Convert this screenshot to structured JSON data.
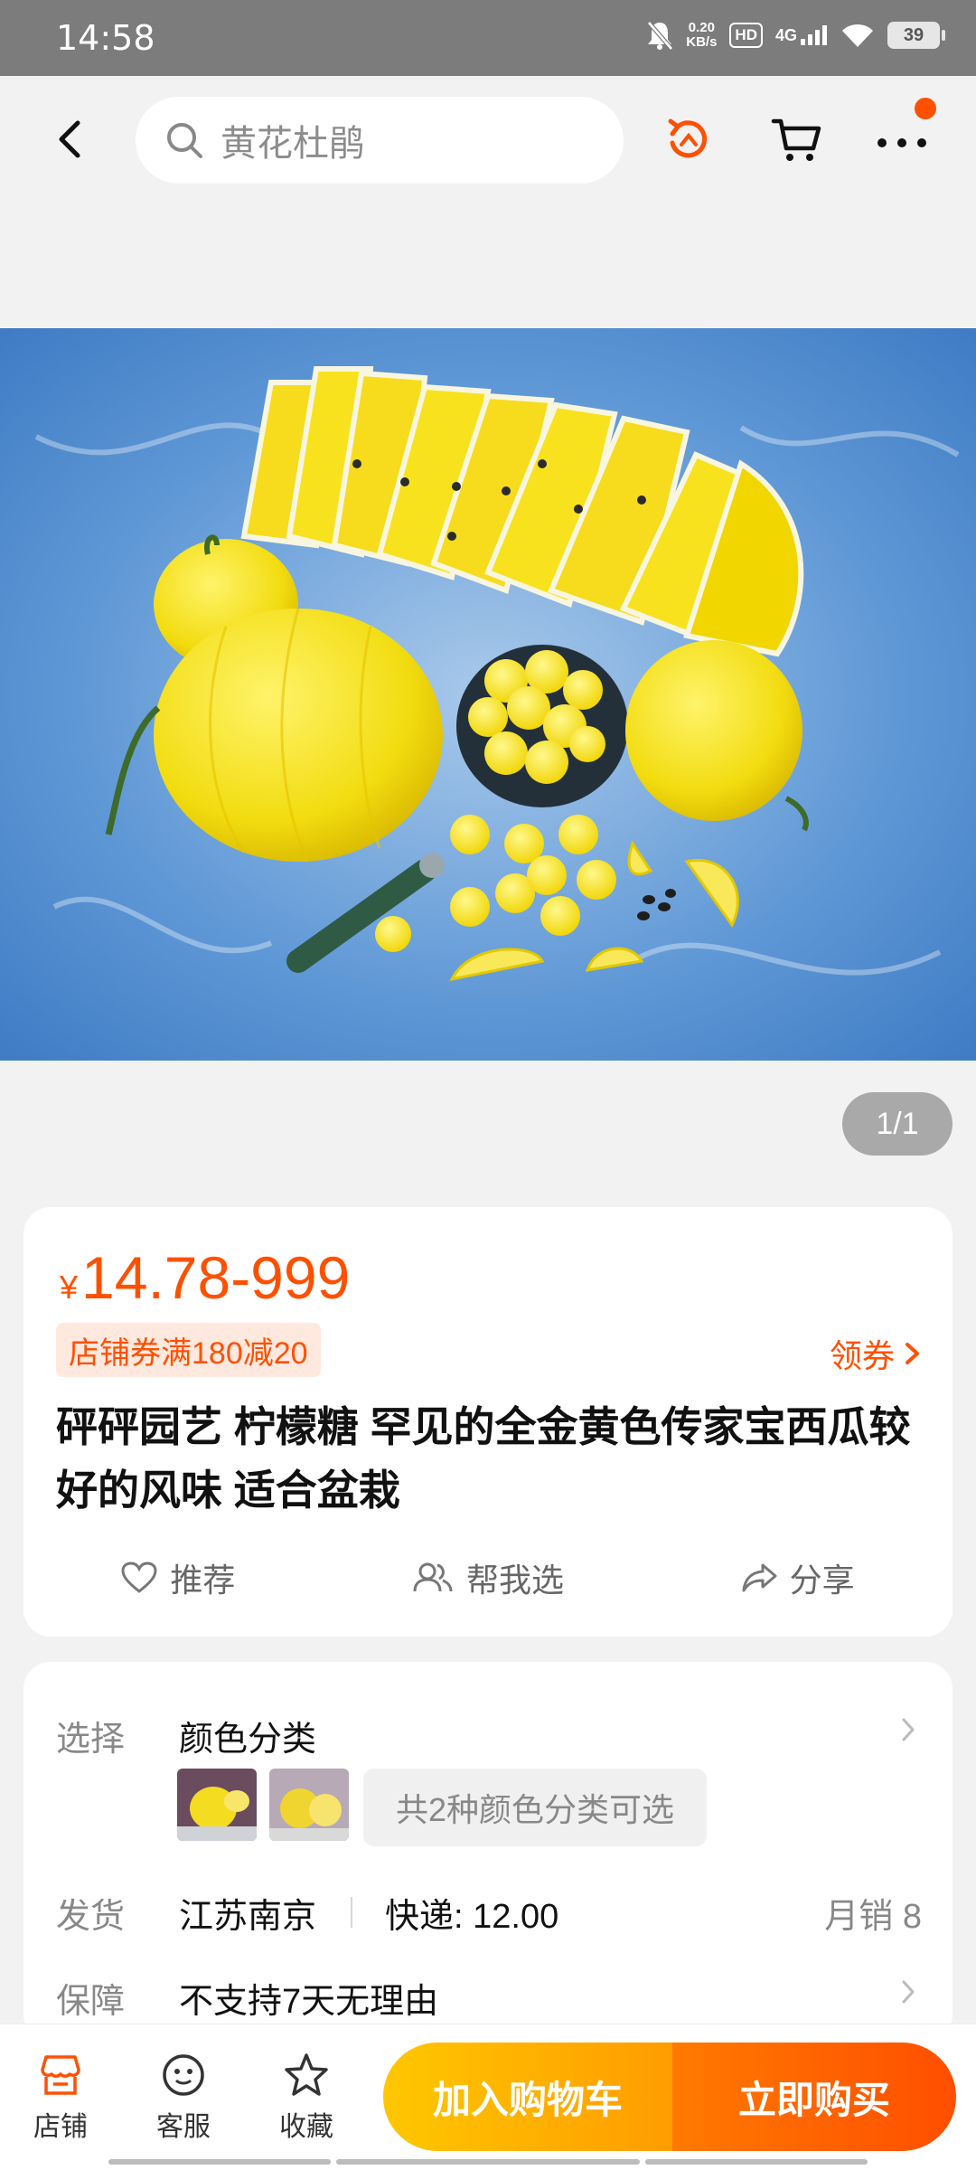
{
  "status_bar": {
    "time": "14:58",
    "net_speed_value": "0.20",
    "net_speed_unit": "KB/s",
    "hd": "HD",
    "signal": "4G",
    "battery": "39"
  },
  "header": {
    "search_text": "黄花杜鹃",
    "icons": [
      "back-icon",
      "search-icon",
      "refresh-share-icon",
      "cart-icon",
      "more-icon"
    ],
    "accent_color": "#ff5000"
  },
  "gallery": {
    "pager": "1/1"
  },
  "product": {
    "currency": "¥",
    "price": "14.78-999",
    "coupon_tag": "店铺券满180减20",
    "get_coupon": "领券",
    "title": "砰砰园艺 柠檬糖 罕见的全金黄色传家宝西瓜较好的风味 适合盆栽",
    "actions": [
      {
        "label": "推荐",
        "icon": "heart-icon"
      },
      {
        "label": "帮我选",
        "icon": "people-icon"
      },
      {
        "label": "分享",
        "icon": "share-icon"
      }
    ]
  },
  "details": {
    "select_label": "选择",
    "select_value": "颜色分类",
    "variants_text": "共2种颜色分类可选",
    "ship_label": "发货",
    "ship_from": "江苏南京",
    "shipping": "快递: 12.00",
    "monthly_sales": "月销 8",
    "guarantee_label": "保障",
    "guarantee_value": "不支持7天无理由"
  },
  "bottom_bar": {
    "store": "店铺",
    "service": "客服",
    "favorite": "收藏",
    "add_to_cart": "加入购物车",
    "buy_now": "立即购买"
  }
}
